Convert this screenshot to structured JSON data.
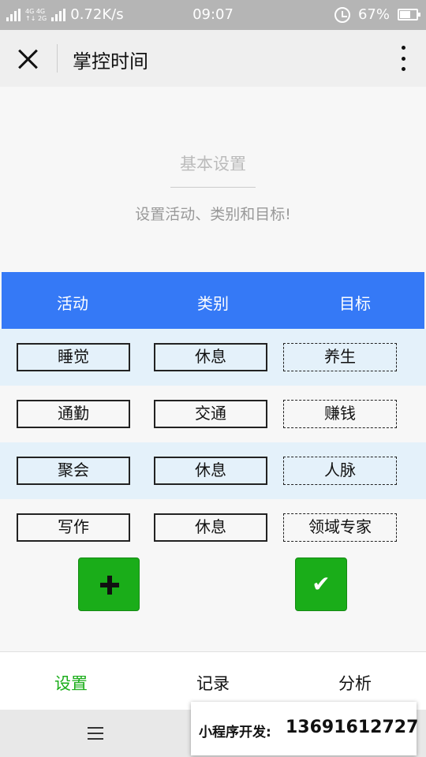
{
  "status_bar": {
    "net_top": "4G 4G",
    "net_bottom": "↑↓ 2G",
    "speed": "0.72K/s",
    "time": "09:07",
    "battery": "67%",
    "battery_level": 0.67,
    "icons": [
      "signal-icon",
      "alarm-icon",
      "battery-icon"
    ]
  },
  "navbar": {
    "title": "掌控时间",
    "icons": [
      "close-icon",
      "more-icon"
    ]
  },
  "header": {
    "title": "基本设置",
    "subtitle": "设置活动、类别和目标!"
  },
  "table": {
    "columns": [
      "活动",
      "类别",
      "目标"
    ],
    "rows": [
      [
        "睡觉",
        "休息",
        "养生"
      ],
      [
        "通勤",
        "交通",
        "赚钱"
      ],
      [
        "聚会",
        "休息",
        "人脉"
      ],
      [
        "写作",
        "休息",
        "领域专家"
      ]
    ]
  },
  "actions": {
    "add_icon": "plus-icon",
    "confirm_label": "✔"
  },
  "tabbar": {
    "tabs": [
      "设置",
      "记录",
      "分析"
    ],
    "active": 0
  },
  "promo": {
    "label": "小程序开发:",
    "phone": "13691612727"
  },
  "colors": {
    "accent": "#3579f6",
    "green": "#1aad19",
    "row_alt": "#e4f1fa"
  }
}
